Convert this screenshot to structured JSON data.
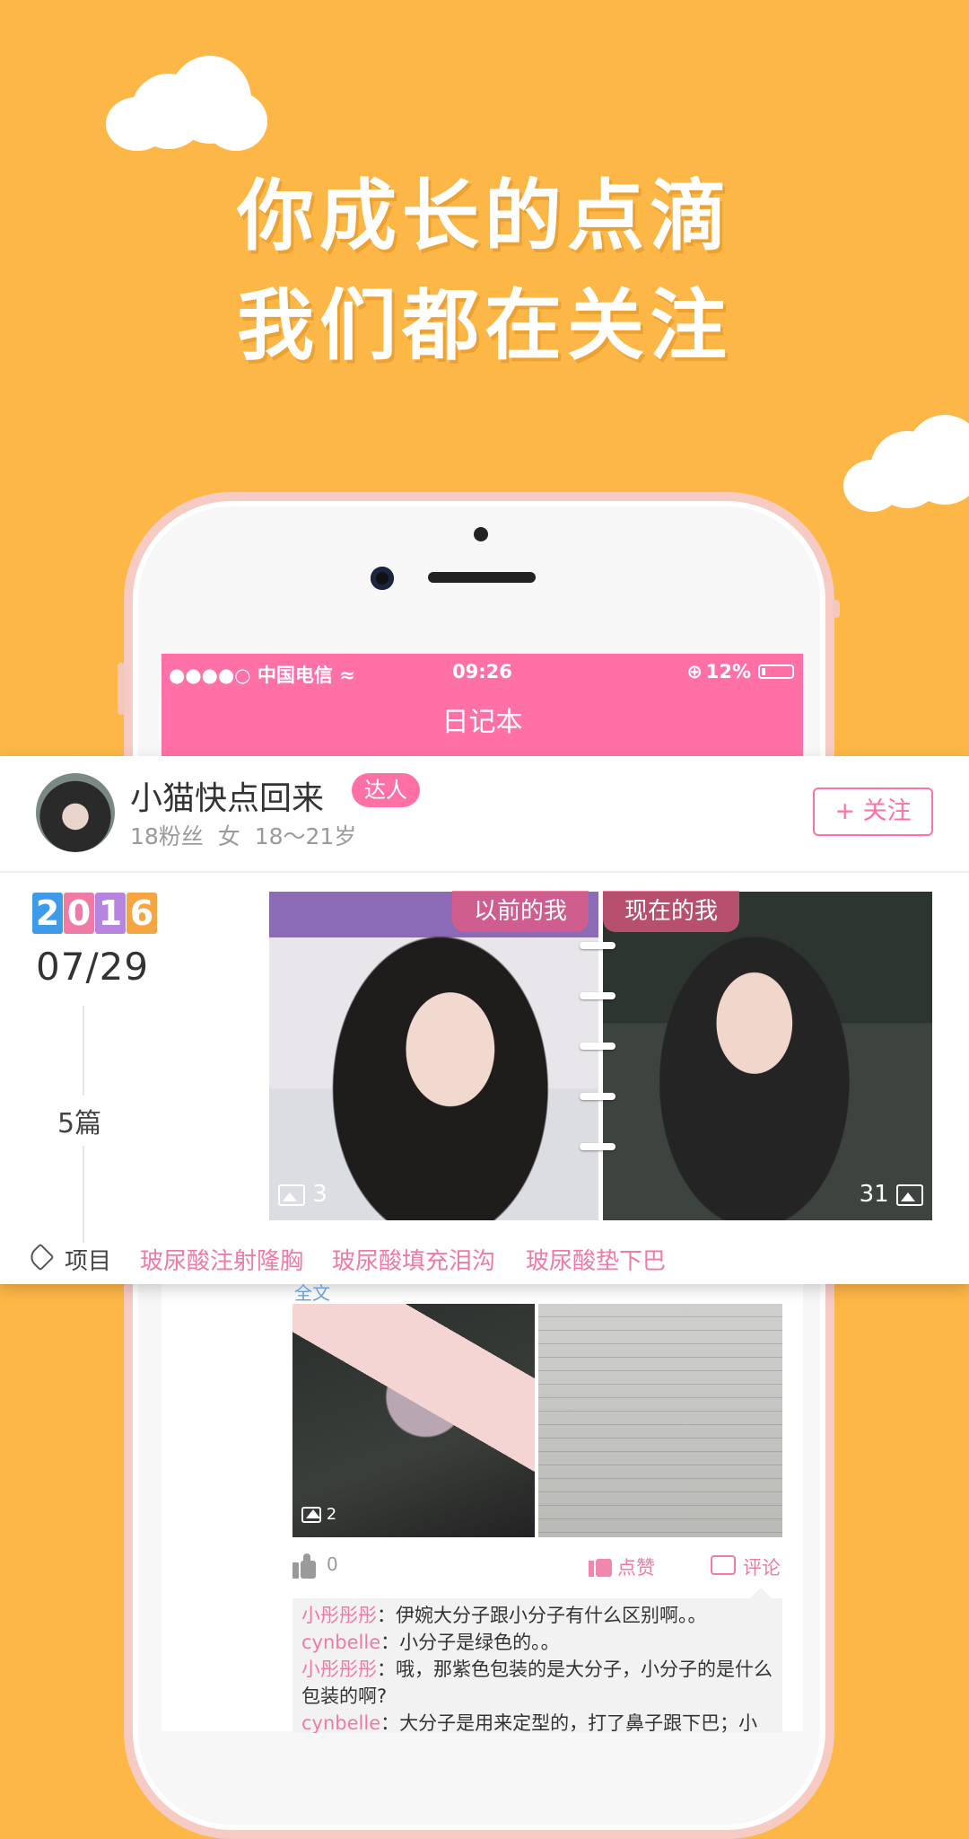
{
  "headline": {
    "line1": "你成长的点滴",
    "line2": "我们都在关注"
  },
  "status_bar": {
    "carrier": "●●●●○ 中国电信 ≈",
    "time": "09:26",
    "battery": "12%",
    "battery_level": 0.12
  },
  "nav": {
    "title": "日记本"
  },
  "user": {
    "name": "小猫快点回来",
    "badge": "达人",
    "info": "18粉丝  女  18～21岁",
    "follow_label": "+ 关注"
  },
  "entry": {
    "year_digits": [
      "2",
      "0",
      "1",
      "6"
    ],
    "year_colors": [
      "#3D9BE9",
      "#F07AA6",
      "#B784E0",
      "#F7A541"
    ],
    "date": "07/29",
    "count": "5篇",
    "before_label": "以前的我",
    "after_label": "现在的我",
    "before_images": "3",
    "after_images": "31"
  },
  "tags": {
    "label": "项目",
    "items": [
      "玻尿酸注射隆胸",
      "玻尿酸填充泪沟",
      "玻尿酸垫下巴"
    ]
  },
  "feed": {
    "partial_text": "全文",
    "image_count": "2",
    "likes": "0",
    "like_label": "点赞",
    "comment_label": "评论",
    "comments": [
      {
        "user": "小彤彤彤",
        "text": "：伊婉大分子跟小分子有什么区别啊。。"
      },
      {
        "user": "cynbelle",
        "text": "：小分子是绿色的。。"
      },
      {
        "user": "小彤彤彤",
        "text": "：哦，那紫色包装的是大分子，小分子的是什么包装的啊?"
      },
      {
        "user": "cynbelle",
        "text": "：大分子是用来定型的，打了鼻子跟下巴；小分"
      }
    ]
  },
  "colors": {
    "background": "#FDB746",
    "accent": "#FF70A6",
    "tag_text": "#F07AA6"
  }
}
